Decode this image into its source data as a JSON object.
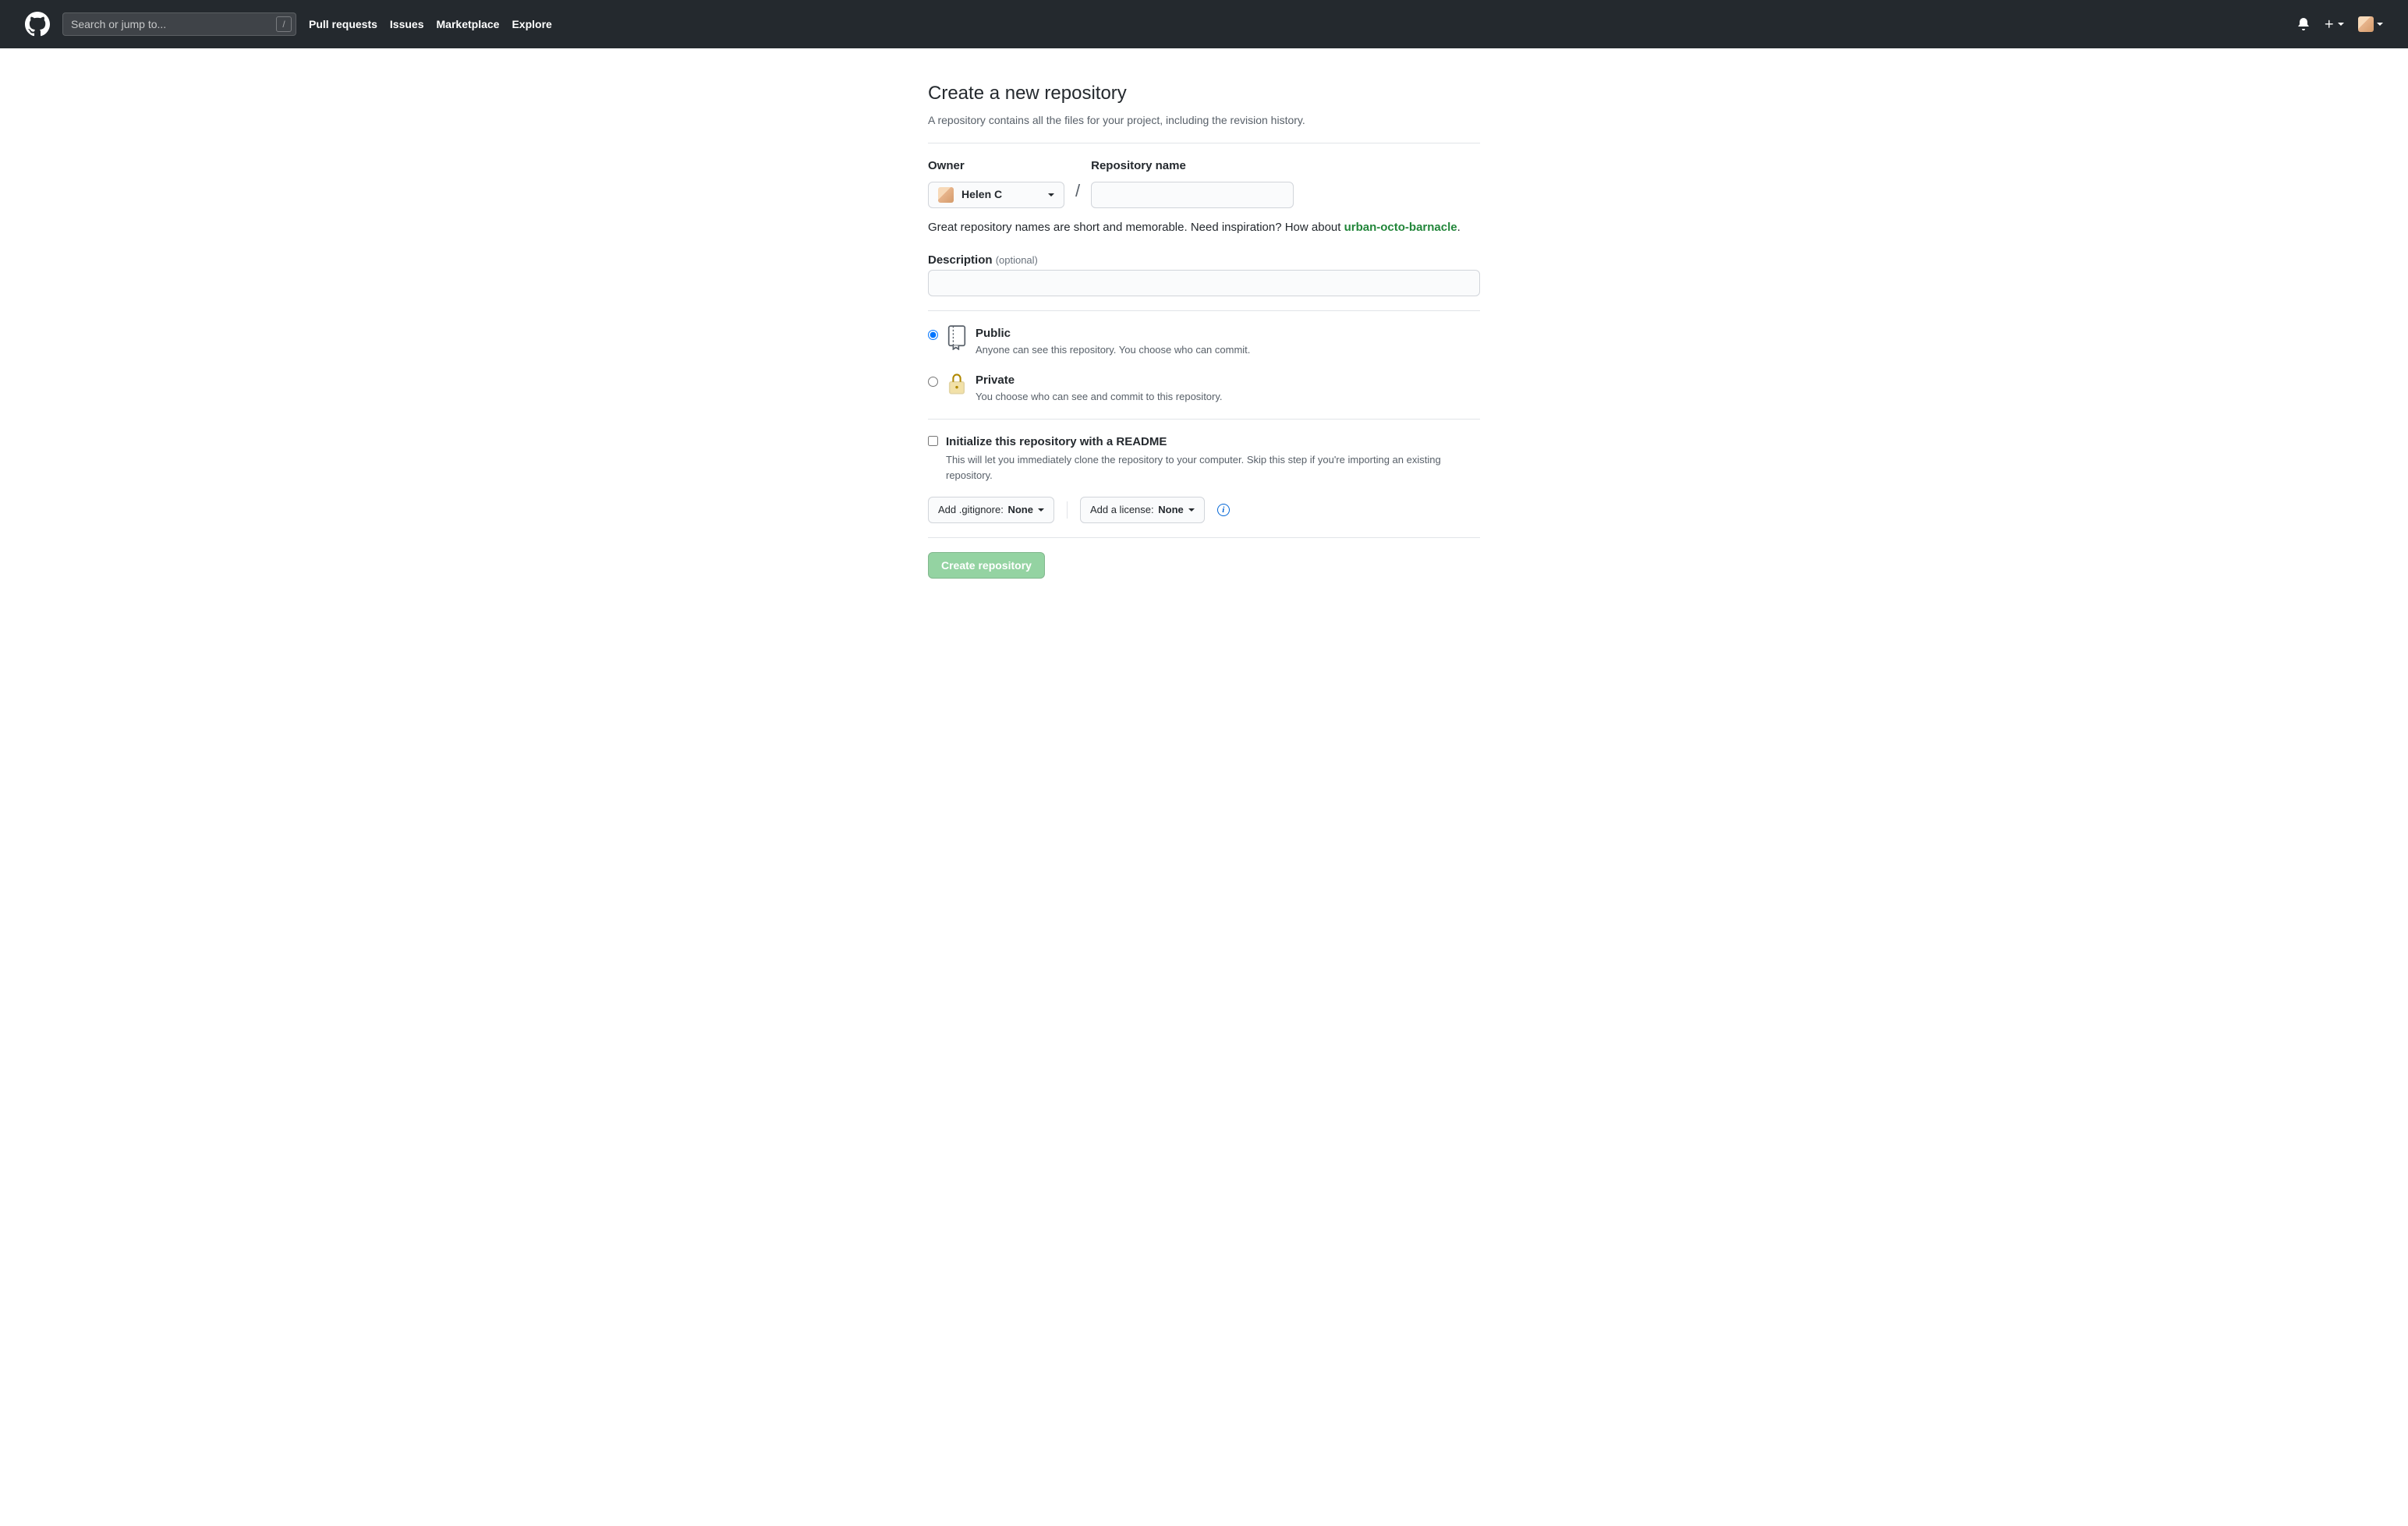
{
  "header": {
    "search_placeholder": "Search or jump to...",
    "slash_hint": "/",
    "nav": [
      "Pull requests",
      "Issues",
      "Marketplace",
      "Explore"
    ]
  },
  "page": {
    "title": "Create a new repository",
    "subtitle": "A repository contains all the files for your project, including the revision history."
  },
  "form": {
    "owner_label": "Owner",
    "owner_value": "Helen C",
    "slash": "/",
    "repo_name_label": "Repository name",
    "hint_prefix": "Great repository names are short and memorable. Need inspiration? How about ",
    "hint_suggestion": "urban-octo-barnacle",
    "hint_suffix": ".",
    "description_label": "Description",
    "description_optional": "(optional)"
  },
  "visibility": {
    "public": {
      "title": "Public",
      "desc": "Anyone can see this repository. You choose who can commit."
    },
    "private": {
      "title": "Private",
      "desc": "You choose who can see and commit to this repository."
    }
  },
  "init": {
    "readme_title": "Initialize this repository with a README",
    "readme_desc": "This will let you immediately clone the repository to your computer. Skip this step if you're importing an existing repository.",
    "gitignore_label": "Add .gitignore:",
    "gitignore_value": "None",
    "license_label": "Add a license:",
    "license_value": "None"
  },
  "submit": {
    "label": "Create repository"
  }
}
